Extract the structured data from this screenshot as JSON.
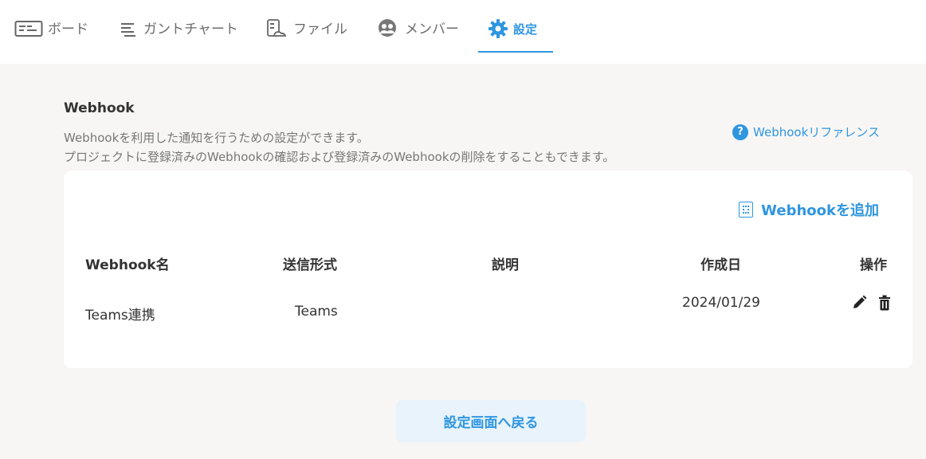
{
  "tabs": [
    {
      "label": "ボード",
      "icon": "board-icon"
    },
    {
      "label": "ガントチャート",
      "icon": "gantt-icon"
    },
    {
      "label": "ファイル",
      "icon": "file-icon"
    },
    {
      "label": "メンバー",
      "icon": "members-icon"
    },
    {
      "label": "設定",
      "icon": "gear-icon",
      "active": true
    }
  ],
  "section": {
    "title": "Webhook",
    "description_line1": "Webhookを利用した通知を行うための設定ができます。",
    "description_line2": "プロジェクトに登録済みのWebhookの確認および登録済みのWebhookの削除をすることもできます。",
    "reference_link": "Webhookリファレンス"
  },
  "card": {
    "add_button": "Webhookを追加",
    "columns": [
      "Webhook名",
      "送信形式",
      "説明",
      "作成日",
      "操作"
    ],
    "rows": [
      {
        "name": "Teams連携",
        "format": "Teams",
        "description": "",
        "created": "2024/01/29"
      }
    ]
  },
  "back_button": "設定画面へ戻る",
  "colors": {
    "accent": "#2f96e0",
    "background": "#f7f6f5",
    "card": "#ffffff"
  }
}
